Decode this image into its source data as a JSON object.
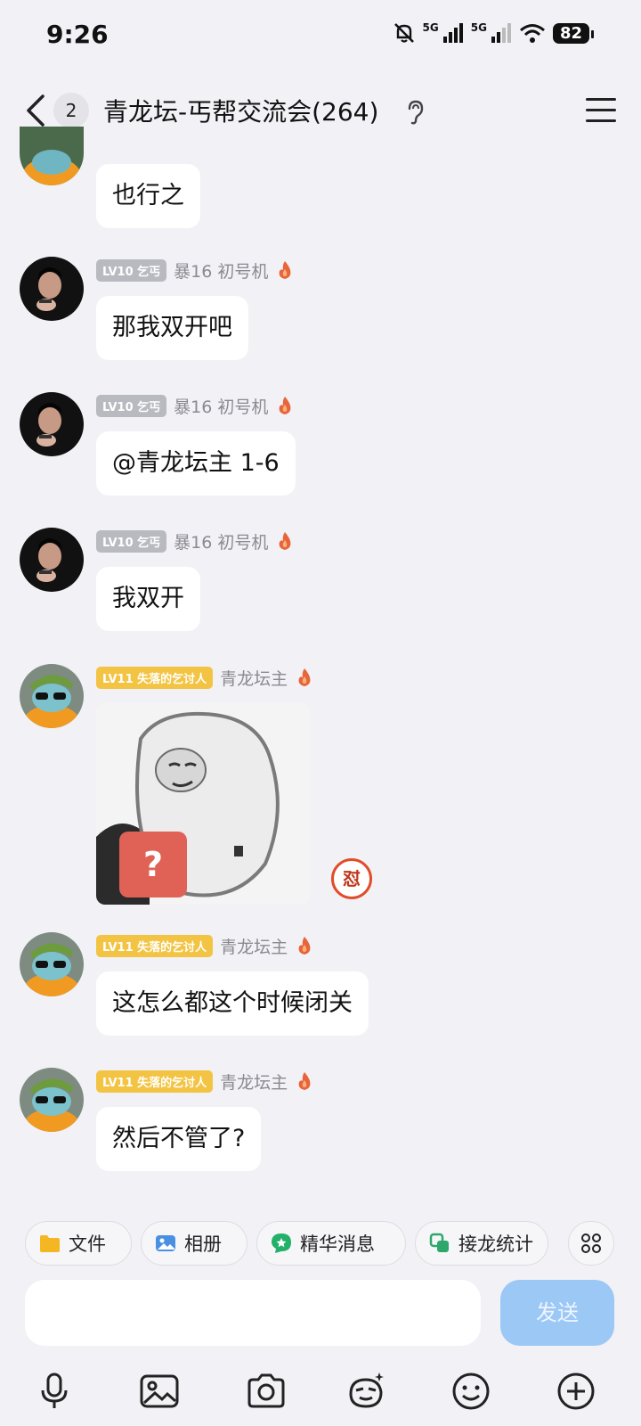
{
  "status_bar": {
    "time": "9:26",
    "network_1": "5G",
    "network_2": "5G",
    "battery": "82",
    "icons": [
      "mute-bell-icon",
      "signal-icon",
      "signal-icon",
      "wifi-icon",
      "battery-icon"
    ]
  },
  "header": {
    "unread_count": "2",
    "title": "青龙坛-丐帮交流会(264)",
    "icons": [
      "back-chevron-icon",
      "ear-icon",
      "menu-icon"
    ]
  },
  "messages": [
    {
      "text": "也行之"
    },
    {
      "badge": "LV10 乞丐",
      "nickname": "暴16 初号机",
      "text": "那我双开吧"
    },
    {
      "badge": "LV10 乞丐",
      "nickname": "暴16 初号机",
      "text": "@青龙坛主 1-6"
    },
    {
      "badge": "LV10 乞丐",
      "nickname": "暴16 初号机",
      "text": "我双开"
    },
    {
      "badge": "LV11 失落的乞讨人",
      "nickname": "青龙坛主",
      "sticker_text": "?",
      "reaction": "怼"
    },
    {
      "badge": "LV11 失落的乞讨人",
      "nickname": "青龙坛主",
      "text": "这怎么都这个时候闭关"
    },
    {
      "badge": "LV11 失落的乞讨人",
      "nickname": "青龙坛主",
      "text": "然后不管了?"
    }
  ],
  "quick_actions": [
    {
      "label": "文件",
      "icon": "folder-icon"
    },
    {
      "label": "相册",
      "icon": "photo-album-icon"
    },
    {
      "label": "精华消息",
      "icon": "star-chat-icon"
    },
    {
      "label": "接龙统计",
      "icon": "chain-icon"
    }
  ],
  "input": {
    "placeholder": "",
    "send_label": "发送"
  },
  "toolbar_icons": [
    "microphone-icon",
    "image-icon",
    "camera-icon",
    "sticker-face-icon",
    "emoji-icon",
    "plus-icon"
  ],
  "colors": {
    "background": "#f1f1f6",
    "bubble": "#ffffff",
    "badge_gray": "#b9b9c0",
    "badge_gold": "#f3c443",
    "send_button": "#9cc8f6",
    "flame": "#e8643a"
  }
}
